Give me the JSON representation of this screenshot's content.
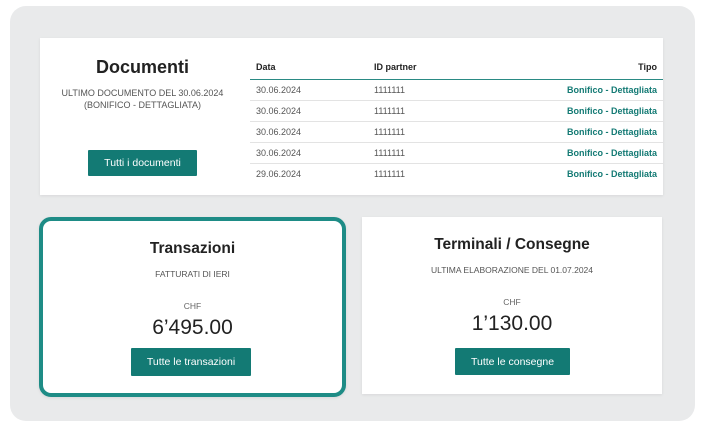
{
  "documents": {
    "title": "Documenti",
    "subtitle_line1": "ULTIMO DOCUMENTO DEL 30.06.2024",
    "subtitle_line2": "(BONIFICO - DETTAGLIATA)",
    "button_label": "Tutti i documenti",
    "table": {
      "headers": [
        "Data",
        "ID partner",
        "Tipo"
      ],
      "rows": [
        [
          "30.06.2024",
          "1111111",
          "Bonifico - Dettagliata"
        ],
        [
          "30.06.2024",
          "1111111",
          "Bonifico - Dettagliata"
        ],
        [
          "30.06.2024",
          "1111111",
          "Bonifico - Dettagliata"
        ],
        [
          "30.06.2024",
          "1111111",
          "Bonifico - Dettagliata"
        ],
        [
          "29.06.2024",
          "1111111",
          "Bonifico - Dettagliata"
        ]
      ]
    }
  },
  "transactions": {
    "title": "Transazioni",
    "subtitle": "FATTURATI DI IERI",
    "currency": "CHF",
    "amount": "6’495.00",
    "button_label": "Tutte le transazioni"
  },
  "terminals": {
    "title": "Terminali / Consegne",
    "subtitle": "ULTIMA ELABORAZIONE DEL 01.07.2024",
    "currency": "CHF",
    "amount": "1’130.00",
    "button_label": "Tutte le consegne"
  },
  "colors": {
    "accent": "#137a74",
    "highlight_border": "#1e8c86",
    "background": "#e9eaeb"
  }
}
